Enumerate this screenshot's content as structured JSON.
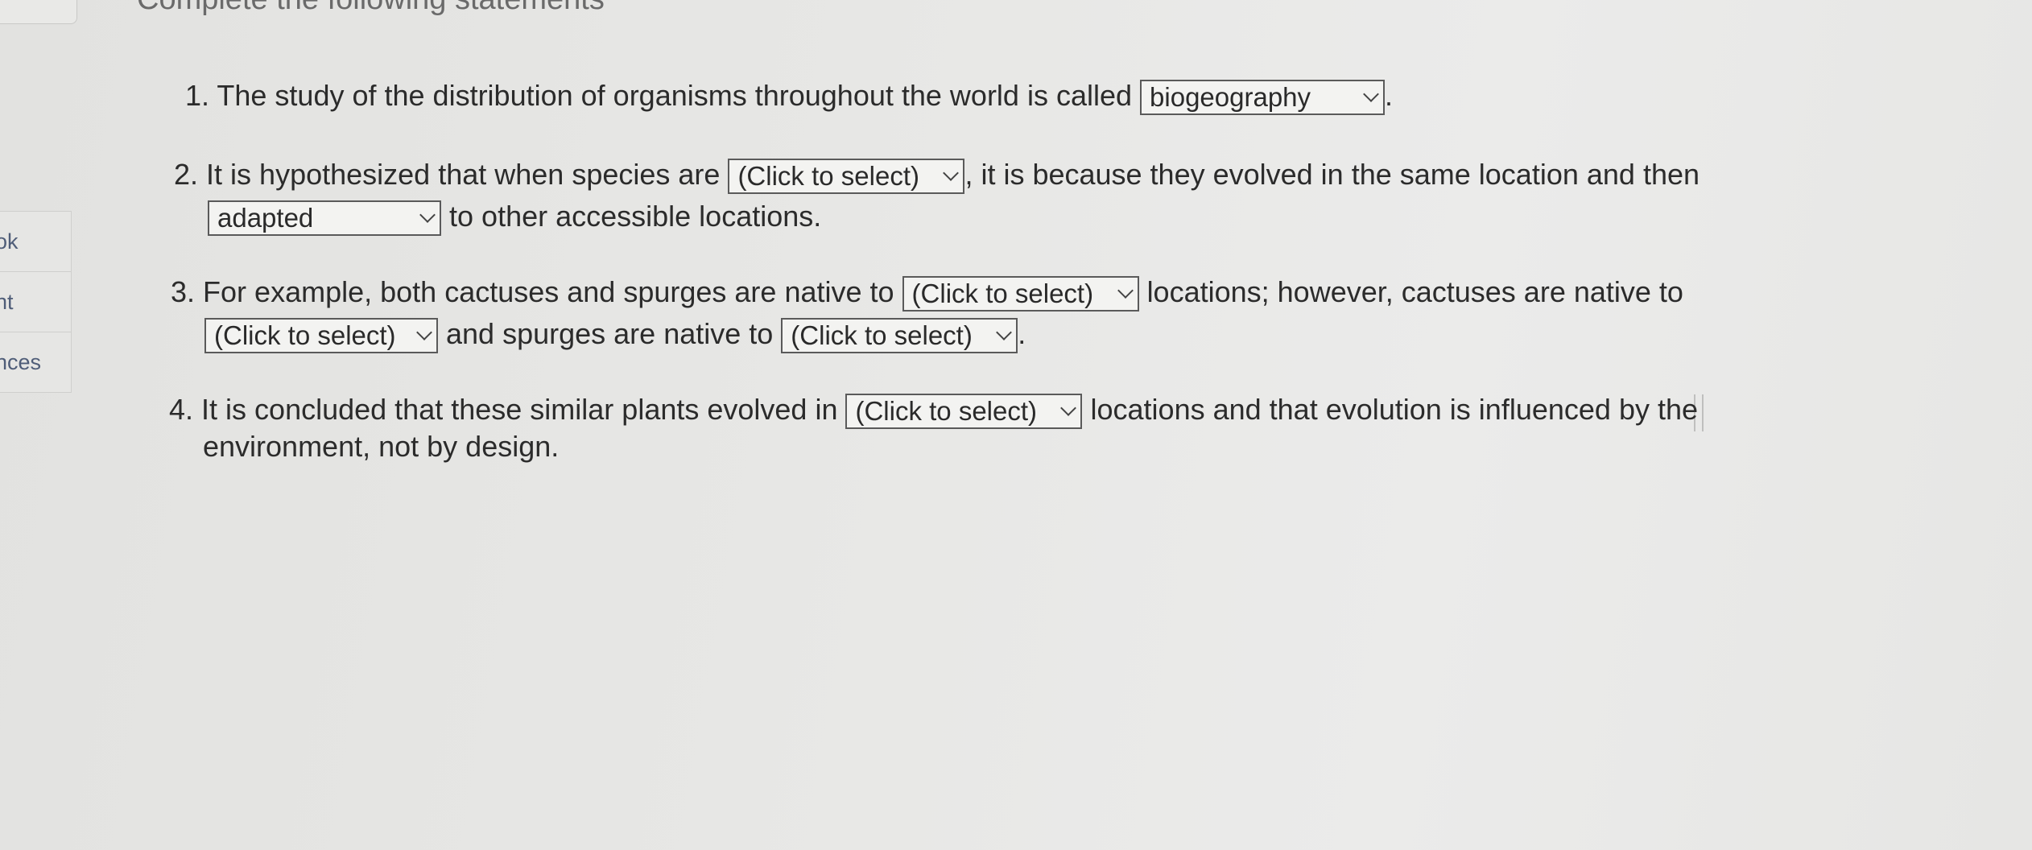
{
  "header": {
    "instruction": "Complete the following statements"
  },
  "side_nav": {
    "items": [
      {
        "label": "ok"
      },
      {
        "label": "nt"
      },
      {
        "label": "nces"
      }
    ]
  },
  "questions": [
    {
      "number": "1.",
      "text_before": "The study of the distribution of organisms throughout the world is called",
      "select_1": "biogeography",
      "text_after": "."
    },
    {
      "number": "2.",
      "text_before": "It is hypothesized that when species are",
      "select_1": "(Click to select)",
      "text_middle": ", it is because they evolved in the same location and then",
      "select_2": "adapted",
      "text_after": "to other accessible locations."
    },
    {
      "number": "3.",
      "text_before": "For example, both cactuses and spurges are native to",
      "select_1": "(Click to select)",
      "text_middle": "locations; however, cactuses are native to",
      "select_2": "(Click to select)",
      "text_middle_2": "and spurges are native to",
      "select_3": "(Click to select)",
      "text_after": "."
    },
    {
      "number": "4.",
      "text_before": "It is concluded that these similar plants evolved in",
      "select_1": "(Click to select)",
      "text_middle": "locations and that evolution is influenced by the",
      "text_after": "environment, not by design."
    }
  ]
}
